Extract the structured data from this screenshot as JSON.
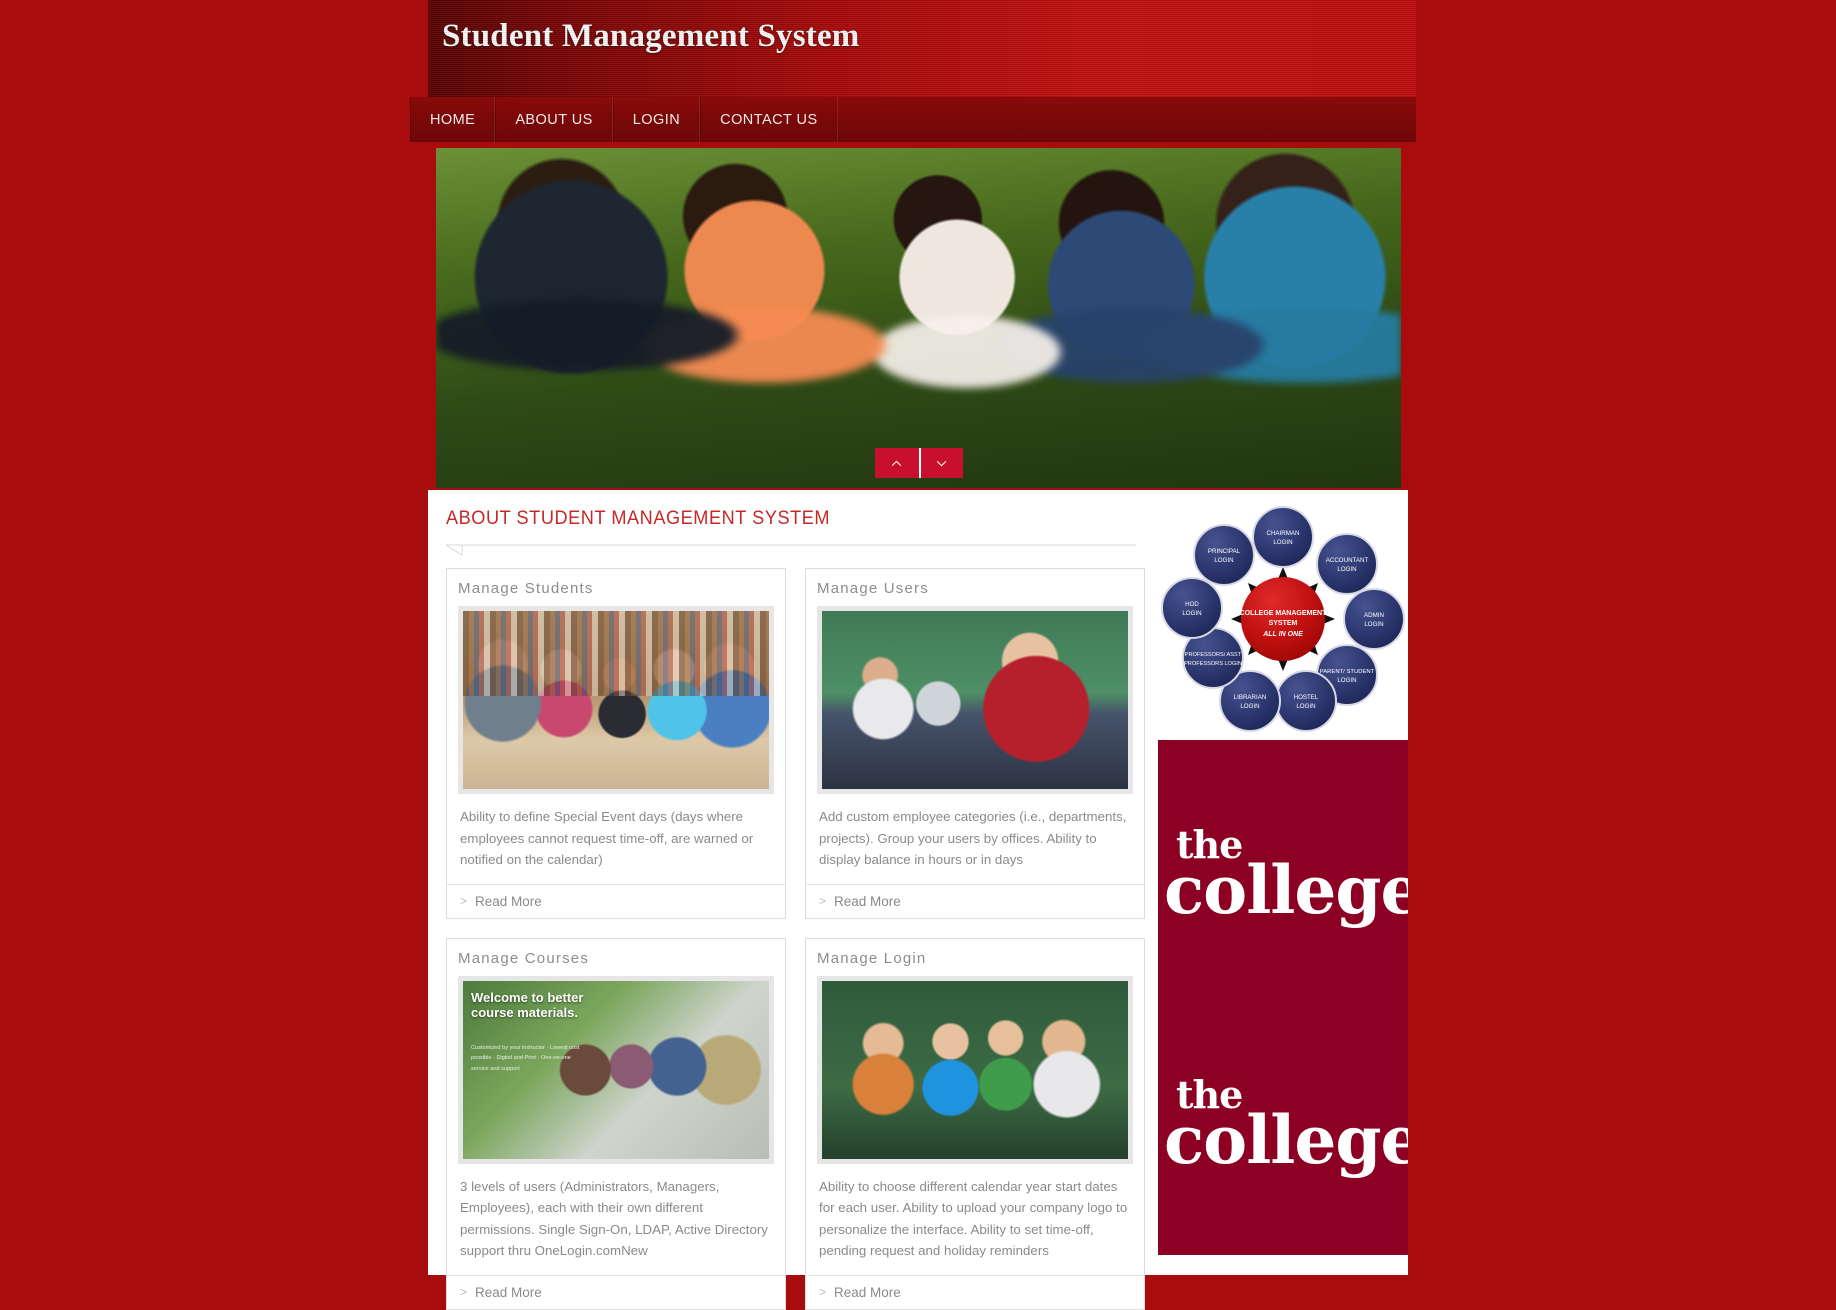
{
  "site": {
    "title": "Student Management System",
    "theme": {
      "page_bg": "#a80c0c",
      "header_red": "#c21212",
      "nav_red": "#7a0808",
      "accent_red": "#c62828",
      "banner_maroon": "#8c0024",
      "slider_btn_red": "#c8102e"
    }
  },
  "nav": {
    "items": [
      {
        "label": "HOME"
      },
      {
        "label": "ABOUT US"
      },
      {
        "label": "LOGIN"
      },
      {
        "label": "CONTACT US"
      }
    ]
  },
  "slider": {
    "prev_icon": "chevron-up-icon",
    "next_icon": "chevron-down-icon",
    "caption": ""
  },
  "main": {
    "section_title": "ABOUT STUDENT MANAGEMENT SYSTEM",
    "read_more_label": "Read More",
    "read_more_icon": ">",
    "cards": [
      {
        "title": "Manage Students",
        "description": "Ability to define Special Event days (days where employees cannot request time-off, are warned or notified on the calendar)",
        "read_more": "Read More"
      },
      {
        "title": "Manage Users",
        "description": "Add custom employee categories (i.e., departments, projects). Group your users by offices. Ability to display balance in hours or in days",
        "read_more": "Read More"
      },
      {
        "title": "Manage Courses",
        "description": "3 levels of users (Administrators, Managers, Employees), each with their own different permissions. Single Sign-On, LDAP, Active Directory support thru OneLogin.comNew",
        "read_more": "Read More"
      },
      {
        "title": "Manage Login",
        "description": "Ability to choose different calendar year start dates for each user. Ability to upload your company logo to personalize the interface. Ability to set time-off, pending request and holiday reminders",
        "read_more": "Read More"
      }
    ]
  },
  "sidebar": {
    "diagram": {
      "center": {
        "line1": "COLLEGE MANAGEMENT",
        "line2": "SYSTEM",
        "line3": "ALL IN ONE"
      },
      "nodes": [
        {
          "line1": "CHAIRMAN",
          "line2": "LOGIN"
        },
        {
          "line1": "ACCOUNTANT",
          "line2": "LOGIN"
        },
        {
          "line1": "ADMIN",
          "line2": "LOGIN"
        },
        {
          "line1": "PARENT/ STUDENT",
          "line2": "LOGIN"
        },
        {
          "line1": "HOSTEL",
          "line2": "LOGIN"
        },
        {
          "line1": "LIBRARIAN",
          "line2": "LOGIN"
        },
        {
          "line1": "PROFESSORS/ ASST",
          "line2": "PROFESSORS LOGIN"
        },
        {
          "line1": "HOD",
          "line2": "LOGIN"
        },
        {
          "line1": "PRINCIPAL",
          "line2": "LOGIN"
        }
      ]
    },
    "banner": {
      "word_the": "the",
      "word_college": "college"
    }
  }
}
